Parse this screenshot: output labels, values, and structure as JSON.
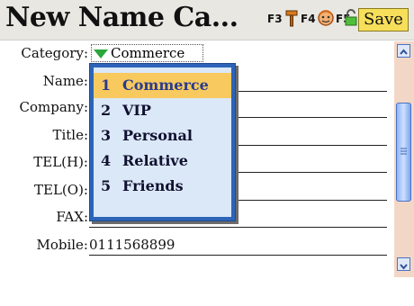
{
  "title": "New Name Ca...",
  "toolbar": {
    "f3": "F3",
    "f4": "F4",
    "f5": "F5",
    "save_label": "Save"
  },
  "form": {
    "category_label": "Category:",
    "category_value": "Commerce",
    "name_label": "Name:",
    "company_label": "Company:",
    "title_label": "Title:",
    "tel_h_label": "TEL(H):",
    "tel_o_label": "TEL(O):",
    "fax_label": "FAX:",
    "mobile_label": "Mobile:",
    "mobile_value": "0111568899"
  },
  "dropdown": {
    "items": [
      {
        "num": "1",
        "label": "Commerce",
        "selected": true
      },
      {
        "num": "2",
        "label": "VIP"
      },
      {
        "num": "3",
        "label": "Personal"
      },
      {
        "num": "4",
        "label": "Relative"
      },
      {
        "num": "5",
        "label": "Friends"
      }
    ]
  },
  "colors": {
    "accent": "#2d64b8",
    "selection": "#f7c95e",
    "save_button": "#f7df5a",
    "scroll_track": "#f3d7c6"
  },
  "icons": [
    "hammer-icon",
    "contact-face-icon",
    "unlock-icon",
    "chevron-up-icon",
    "chevron-down-icon"
  ]
}
